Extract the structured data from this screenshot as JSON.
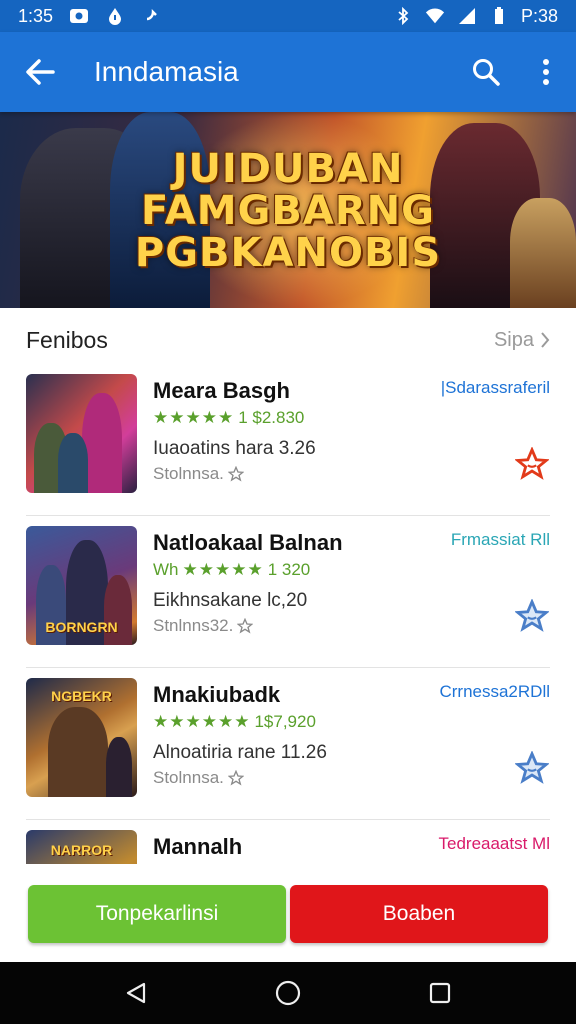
{
  "status_bar": {
    "time": "1:35",
    "battery_text": "P:38"
  },
  "app_bar": {
    "title": "Inndamasia"
  },
  "banner": {
    "lines": [
      "JUIDUBAN",
      "FAMGBARNG",
      "PGBKANOBIS"
    ]
  },
  "section": {
    "title": "Fenibos",
    "more_label": "Sipa"
  },
  "games": [
    {
      "name": "Meara Basgh",
      "tag": "|Sdarassraferil",
      "tag_color": "#1e73d6",
      "stars": "★★★★★",
      "rating": "1 $2.830",
      "desc": "Iuaoatins hara 3.26",
      "sub": "Stolnnsa.",
      "fav_color": "#e23a1a",
      "thumb_label": ""
    },
    {
      "name": "Natloakaal Balnan",
      "tag": "Frmassiat Rll",
      "tag_color": "#2aa6b5",
      "stars": "★★★★★",
      "rating": "1 320",
      "stars_prefix": "Wh",
      "desc": "Eikhnsakane lc,20",
      "sub": "Stnlnns32.",
      "fav_color": "#4a7ec8",
      "thumb_label": "BORNGRN"
    },
    {
      "name": "Mnakiubadk",
      "tag": "Crrnessa2RDll",
      "tag_color": "#1e73d6",
      "stars": "★★★★★★",
      "rating": "1$7,920",
      "desc": "Alnoatiria rane 11.26",
      "sub": "Stolnnsa.",
      "fav_color": "#4a7ec8",
      "thumb_label": "NGBEKR"
    },
    {
      "name": "Mannalh",
      "tag": "Tedreaaatst Ml",
      "tag_color": "#d91a6a",
      "stars": "",
      "rating": "",
      "desc": "",
      "sub": "",
      "fav_color": "#4a7ec8",
      "thumb_label": "NARROR"
    }
  ],
  "actions": {
    "primary_label": "Tonpekarlinsi",
    "secondary_label": "Boaben"
  }
}
